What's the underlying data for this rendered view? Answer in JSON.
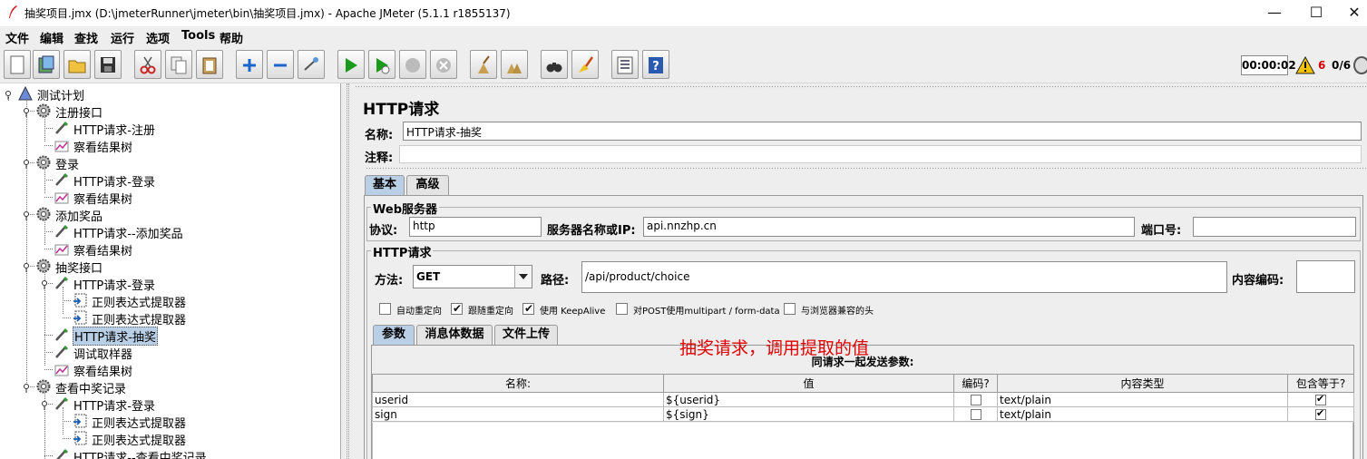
{
  "window": {
    "title": "抽奖项目.jmx (D:\\jmeterRunner\\jmeter\\bin\\抽奖项目.jmx) - Apache JMeter (5.1.1 r1855137)",
    "minimize": "—",
    "maximize": "☐",
    "close": "✕"
  },
  "menu": [
    "文件",
    "编辑",
    "查找",
    "运行",
    "选项",
    "Tools",
    "帮助"
  ],
  "toolbar": {
    "timer": "00:00:02",
    "warning_count": "6",
    "threads": "0/6"
  },
  "tree": [
    {
      "label": "测试计划",
      "icon": "test-plan-icon"
    },
    {
      "label": "注册接口",
      "icon": "thread-group-gear-icon"
    },
    {
      "label": "HTTP请求-注册",
      "icon": "sampler-pen-icon"
    },
    {
      "label": "察看结果树",
      "icon": "listener-chart-icon"
    },
    {
      "label": "登录",
      "icon": "thread-group-gear-icon"
    },
    {
      "label": "HTTP请求-登录",
      "icon": "sampler-pen-icon"
    },
    {
      "label": "察看结果树",
      "icon": "listener-chart-icon"
    },
    {
      "label": "添加奖品",
      "icon": "thread-group-gear-icon"
    },
    {
      "label": "HTTP请求--添加奖品",
      "icon": "sampler-pen-icon"
    },
    {
      "label": "察看结果树",
      "icon": "listener-chart-icon"
    },
    {
      "label": "抽奖接口",
      "icon": "thread-group-gear-icon"
    },
    {
      "label": "HTTP请求-登录",
      "icon": "sampler-pen-icon"
    },
    {
      "label": "正则表达式提取器",
      "icon": "extractor-icon"
    },
    {
      "label": "正则表达式提取器",
      "icon": "extractor-icon"
    },
    {
      "label": "HTTP请求-抽奖",
      "icon": "sampler-pen-icon",
      "selected": true
    },
    {
      "label": "调试取样器",
      "icon": "sampler-pen-icon"
    },
    {
      "label": "察看结果树",
      "icon": "listener-chart-icon"
    },
    {
      "label": "查看中奖记录",
      "icon": "thread-group-gear-icon"
    },
    {
      "label": "HTTP请求-登录",
      "icon": "sampler-pen-icon"
    },
    {
      "label": "正则表达式提取器",
      "icon": "extractor-icon"
    },
    {
      "label": "正则表达式提取器",
      "icon": "extractor-icon"
    },
    {
      "label": "HTTP请求--查看中奖记录",
      "icon": "sampler-pen-icon"
    }
  ],
  "panel": {
    "title": "HTTP请求",
    "name_label": "名称:",
    "name_value": "HTTP请求-抽奖",
    "comment_label": "注释:",
    "comment_value": "",
    "tabs": [
      "基本",
      "高级"
    ],
    "web_server": {
      "group_title": "Web服务器",
      "protocol_label": "协议:",
      "protocol_value": "http",
      "server_label": "服务器名称或IP:",
      "server_value": "api.nnzhp.cn",
      "port_label": "端口号:",
      "port_value": ""
    },
    "http_request": {
      "group_title": "HTTP请求",
      "method_label": "方法:",
      "method_value": "GET",
      "path_label": "路径:",
      "path_value": "/api/product/choice",
      "encoding_label": "内容编码:",
      "encoding_value": ""
    },
    "checkboxes": [
      {
        "label": "自动重定向",
        "checked": false
      },
      {
        "label": "跟随重定向",
        "checked": true
      },
      {
        "label": "使用 KeepAlive",
        "checked": true
      },
      {
        "label": "对POST使用multipart / form-data",
        "checked": false
      },
      {
        "label": "与浏览器兼容的头",
        "checked": false
      }
    ],
    "subtabs": [
      "参数",
      "消息体数据",
      "文件上传"
    ],
    "annotation": "抽奖请求，调用提取的值",
    "params_caption": "同请求一起发送参数:",
    "params_columns": [
      "名称:",
      "值",
      "编码?",
      "内容类型",
      "包含等于?"
    ],
    "params_rows": [
      {
        "name": "userid",
        "value": "${userid}",
        "encode": false,
        "content_type": "text/plain",
        "include_equals": true
      },
      {
        "name": "sign",
        "value": "${sign}",
        "encode": false,
        "content_type": "text/plain",
        "include_equals": true
      }
    ]
  }
}
